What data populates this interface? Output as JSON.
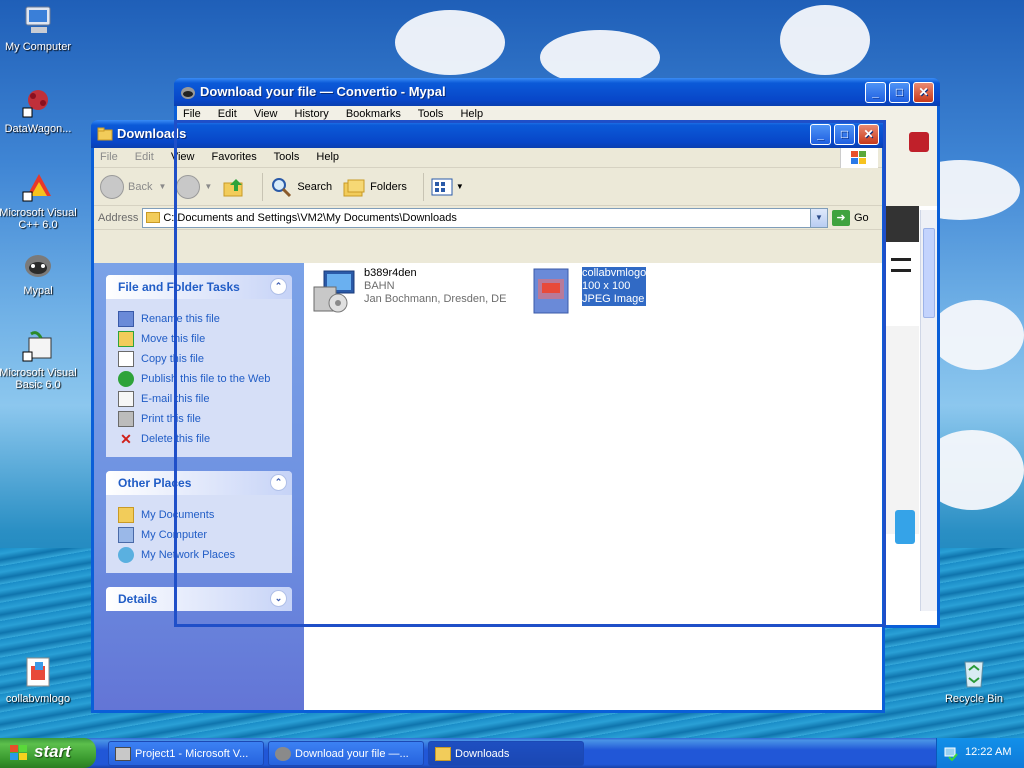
{
  "desktop": {
    "icons": [
      {
        "label": "My Computer"
      },
      {
        "label": "DataWagon..."
      },
      {
        "label": "Microsoft Visual C++ 6.0"
      },
      {
        "label": "Mypal"
      },
      {
        "label": "Microsoft Visual Basic 6.0"
      },
      {
        "label": "collabvmlogo"
      },
      {
        "label": "Recycle Bin"
      }
    ]
  },
  "mypal": {
    "title": "Download your file — Convertio - Mypal",
    "menu": [
      "File",
      "Edit",
      "View",
      "History",
      "Bookmarks",
      "Tools",
      "Help"
    ]
  },
  "explorer": {
    "title": "Downloads",
    "menu": [
      "File",
      "Edit",
      "View",
      "Favorites",
      "Tools",
      "Help"
    ],
    "toolbar": {
      "back": "Back",
      "search": "Search",
      "folders": "Folders"
    },
    "address": {
      "label": "Address",
      "value": "C:\\Documents and Settings\\VM2\\My Documents\\Downloads",
      "go": "Go"
    },
    "panels": {
      "tasks": {
        "title": "File and Folder Tasks",
        "items": [
          "Rename this file",
          "Move this file",
          "Copy this file",
          "Publish this file to the Web",
          "E-mail this file",
          "Print this file",
          "Delete this file"
        ]
      },
      "places": {
        "title": "Other Places",
        "items": [
          "My Documents",
          "My Computer",
          "My Network Places"
        ]
      },
      "details": {
        "title": "Details"
      }
    },
    "files": [
      {
        "name": "b389r4den",
        "line2": "BAHN",
        "line3": "Jan Bochmann, Dresden, DE"
      },
      {
        "name": "collabvmlogo",
        "line2": "100 x 100",
        "line3": "JPEG Image"
      }
    ]
  },
  "taskbar": {
    "start": "start",
    "buttons": [
      "Project1 - Microsoft V...",
      "Download your file —...",
      "Downloads"
    ],
    "clock": "12:22 AM"
  },
  "colors": {
    "xp_blue": "#0a5fd8",
    "task_link": "#215dc6",
    "selection": "#316ac5"
  }
}
